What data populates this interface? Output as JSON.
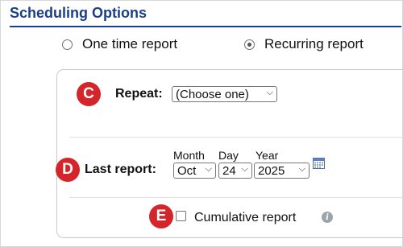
{
  "header": {
    "title": "Scheduling Options"
  },
  "frequency": {
    "options": [
      {
        "label": "One time report",
        "selected": false
      },
      {
        "label": "Recurring report",
        "selected": true
      }
    ]
  },
  "callouts": {
    "c": "C",
    "d": "D",
    "e": "E"
  },
  "repeat": {
    "label": "Repeat:",
    "value": "(Choose one)"
  },
  "last_report": {
    "label": "Last report:",
    "month_label": "Month",
    "day_label": "Day",
    "year_label": "Year",
    "month": "Oct",
    "day": "24",
    "year": "2025"
  },
  "cumulative": {
    "label": "Cumulative report",
    "checked": false,
    "info_icon": "i"
  }
}
